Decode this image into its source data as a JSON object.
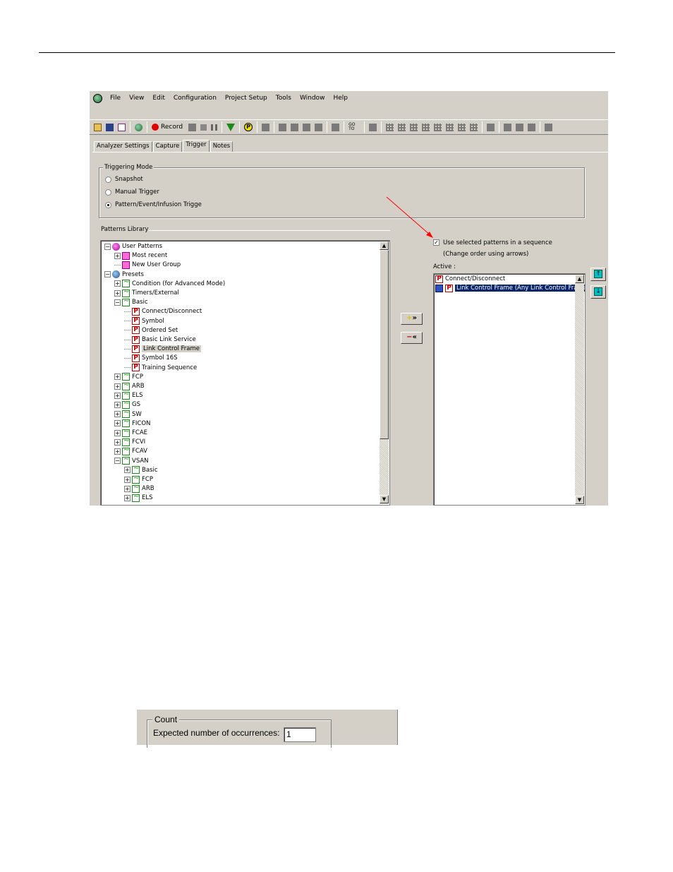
{
  "menubar": {
    "items": [
      "File",
      "View",
      "Edit",
      "Configuration",
      "Project Setup",
      "Tools",
      "Window",
      "Help"
    ]
  },
  "toolbar": {
    "record_label": "Record",
    "goto_label": "GO TO"
  },
  "tabs": [
    "Analyzer Settings",
    "Capture",
    "Trigger",
    "Notes"
  ],
  "triggering_mode": {
    "title": "Triggering Mode",
    "options": [
      "Snapshot",
      "Manual Trigger",
      "Pattern/Event/Infusion Trigge"
    ],
    "selected": 2
  },
  "patterns_library": {
    "title": "Patterns Library",
    "tree": [
      {
        "label": "User Patterns",
        "level": 0,
        "exp": "−",
        "icon": "user"
      },
      {
        "label": "Most recent",
        "level": 1,
        "exp": "+",
        "icon": "grp"
      },
      {
        "label": "New User Group",
        "level": 1,
        "exp": "",
        "icon": "grp"
      },
      {
        "label": "Presets",
        "level": 0,
        "exp": "−",
        "icon": "preset"
      },
      {
        "label": "Condition (for Advanced Mode)",
        "level": 1,
        "exp": "+",
        "icon": "wave"
      },
      {
        "label": "Timers/External",
        "level": 1,
        "exp": "+",
        "icon": "wave"
      },
      {
        "label": "Basic",
        "level": 1,
        "exp": "−",
        "icon": "wave"
      },
      {
        "label": "Connect/Disconnect",
        "level": 2,
        "exp": "",
        "icon": "pat"
      },
      {
        "label": "Symbol",
        "level": 2,
        "exp": "",
        "icon": "pat"
      },
      {
        "label": "Ordered Set",
        "level": 2,
        "exp": "",
        "icon": "pat"
      },
      {
        "label": "Basic Link Service",
        "level": 2,
        "exp": "",
        "icon": "pat"
      },
      {
        "label": "Link Control Frame",
        "level": 2,
        "exp": "",
        "icon": "pat",
        "selected": true
      },
      {
        "label": "Symbol 16S",
        "level": 2,
        "exp": "",
        "icon": "pat"
      },
      {
        "label": "Training Sequence",
        "level": 2,
        "exp": "",
        "icon": "pat"
      },
      {
        "label": "FCP",
        "level": 1,
        "exp": "+",
        "icon": "wave"
      },
      {
        "label": "ARB",
        "level": 1,
        "exp": "+",
        "icon": "wave"
      },
      {
        "label": "ELS",
        "level": 1,
        "exp": "+",
        "icon": "wave"
      },
      {
        "label": "GS",
        "level": 1,
        "exp": "+",
        "icon": "wave"
      },
      {
        "label": "SW",
        "level": 1,
        "exp": "+",
        "icon": "wave"
      },
      {
        "label": "FICON",
        "level": 1,
        "exp": "+",
        "icon": "wave"
      },
      {
        "label": "FCAE",
        "level": 1,
        "exp": "+",
        "icon": "wave"
      },
      {
        "label": "FCVI",
        "level": 1,
        "exp": "+",
        "icon": "wave"
      },
      {
        "label": "FCAV",
        "level": 1,
        "exp": "+",
        "icon": "wave"
      },
      {
        "label": "VSAN",
        "level": 1,
        "exp": "−",
        "icon": "wave"
      },
      {
        "label": "Basic",
        "level": 2,
        "exp": "+",
        "icon": "wave"
      },
      {
        "label": "FCP",
        "level": 2,
        "exp": "+",
        "icon": "wave"
      },
      {
        "label": "ARB",
        "level": 2,
        "exp": "+",
        "icon": "wave"
      },
      {
        "label": "ELS",
        "level": 2,
        "exp": "+",
        "icon": "wave"
      }
    ]
  },
  "sequence": {
    "checkbox_label": "Use selected patterns in a sequence",
    "checked": true,
    "hint": "(Change order using arrows)",
    "active_label": "Active :",
    "active_items": [
      {
        "label": "Connect/Disconnect",
        "selected": false
      },
      {
        "label": "Link Control Frame (Any Link Control Frame Typ",
        "selected": true
      }
    ]
  },
  "count": {
    "title": "Count",
    "label": "Expected number of occurrences:",
    "value": "1"
  },
  "colors": {
    "window_bg": "#d4d0c8",
    "selection": "#0a246a",
    "annotation_arrow": "#ff0000"
  }
}
